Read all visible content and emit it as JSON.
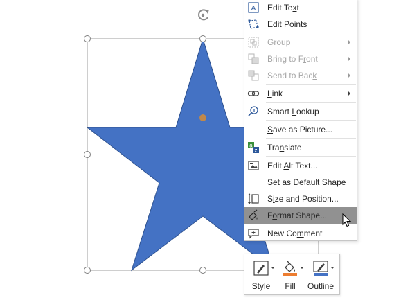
{
  "context_menu": {
    "items": [
      {
        "pre": "Edit Te",
        "key": "x",
        "post": "t",
        "icon": "edit-text-icon",
        "enabled": true,
        "submenu": false
      },
      {
        "pre": "",
        "key": "E",
        "post": "dit Points",
        "icon": "edit-points-icon",
        "enabled": true,
        "submenu": false
      },
      {
        "pre": "",
        "key": "G",
        "post": "roup",
        "icon": "group-icon",
        "enabled": false,
        "submenu": true
      },
      {
        "pre": "Bring to F",
        "key": "r",
        "post": "ont",
        "icon": "bring-to-front-icon",
        "enabled": false,
        "submenu": true
      },
      {
        "pre": "Send to Bac",
        "key": "k",
        "post": "",
        "icon": "send-to-back-icon",
        "enabled": false,
        "submenu": true
      },
      {
        "pre": "",
        "key": "L",
        "post": "ink",
        "icon": "link-icon",
        "enabled": true,
        "submenu": true
      },
      {
        "pre": "Smart ",
        "key": "L",
        "post": "ookup",
        "icon": "smart-lookup-icon",
        "enabled": true,
        "submenu": false
      },
      {
        "pre": "",
        "key": "S",
        "post": "ave as Picture...",
        "icon": "",
        "enabled": true,
        "submenu": false
      },
      {
        "pre": "Tra",
        "key": "n",
        "post": "slate",
        "icon": "translate-icon",
        "enabled": true,
        "submenu": false
      },
      {
        "pre": "Edit ",
        "key": "A",
        "post": "lt Text...",
        "icon": "alt-text-icon",
        "enabled": true,
        "submenu": false
      },
      {
        "pre": "Set as ",
        "key": "D",
        "post": "efault Shape",
        "icon": "",
        "enabled": true,
        "submenu": false
      },
      {
        "pre": "S",
        "key": "i",
        "post": "ze and Position...",
        "icon": "size-position-icon",
        "enabled": true,
        "submenu": false
      },
      {
        "pre": "F",
        "key": "o",
        "post": "rmat Shape...",
        "icon": "format-shape-icon",
        "enabled": true,
        "submenu": false,
        "highlighted": true
      },
      {
        "pre": "New Co",
        "key": "m",
        "post": "ment",
        "icon": "new-comment-icon",
        "enabled": true,
        "submenu": false
      }
    ]
  },
  "mini_toolbar": {
    "style_label": "Style",
    "fill_label": "Fill",
    "outline_label": "Outline"
  },
  "colors": {
    "star_fill": "#4472c4",
    "star_outline": "#2f528f",
    "rotation_handle": "#8a8a8a",
    "center_dot": "#c0884a",
    "fill_accent": "#ed7d31",
    "outline_accent": "#4472c4",
    "menu_highlight": "#919191"
  }
}
